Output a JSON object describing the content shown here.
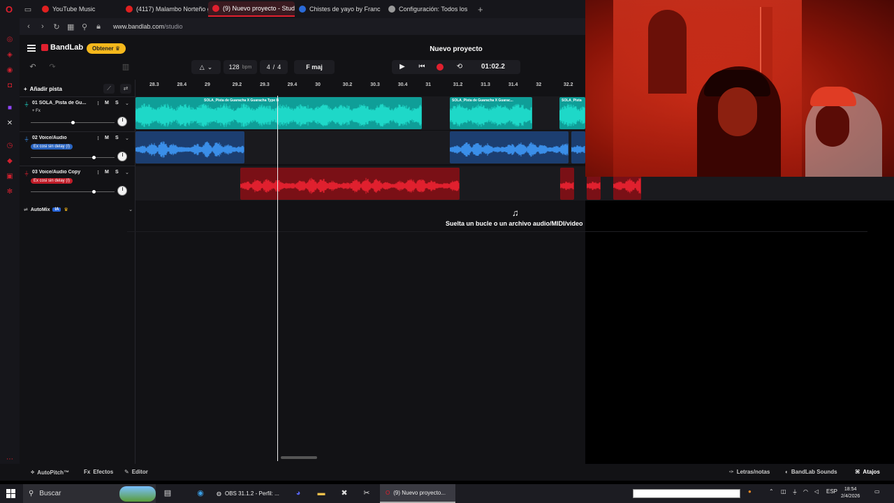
{
  "browser": {
    "tabs": [
      {
        "label": "YouTube Music",
        "color": "#e02020"
      },
      {
        "label": "(4117) Malambo Norteño g",
        "color": "#e02020"
      },
      {
        "label": "(9) Nuevo proyecto - Stud",
        "color": "#e0202e",
        "active": true
      },
      {
        "label": "Chistes de yayo by Franc",
        "color": "#2a6ad8"
      },
      {
        "label": "Configuración: Todos los",
        "color": "#999999"
      }
    ],
    "url_prefix": "www.bandlab.com",
    "url_path": "/studio"
  },
  "bandlab": {
    "logo": "BandLab",
    "get_button": "Obtener",
    "project_title": "Nuevo proyecto",
    "tempo": "128",
    "tempo_unit": "bpm",
    "time_signature_num": "4",
    "time_signature_sep": "/",
    "time_signature_den": "4",
    "key": "F maj",
    "timecode": "01:02.2",
    "add_track": "Añadir pista",
    "ruler": [
      "28.3",
      "28.4",
      "29",
      "29.2",
      "29.3",
      "29.4",
      "30",
      "30.2",
      "30.3",
      "30.4",
      "31",
      "31.2",
      "31.3",
      "31.4",
      "32",
      "32.2"
    ],
    "tracks": [
      {
        "name": "01  SOLA_Pista de Gu...",
        "fx": "+ Fx",
        "color": "#1ed8c8",
        "mute": "M",
        "solo": "S",
        "volume": 0.5
      },
      {
        "name": "02  Voice/Audio",
        "fx": "Ex cosi sin delay (I)",
        "color": "#3a8ee8",
        "mute": "M",
        "solo": "S",
        "volume": 0.75
      },
      {
        "name": "03  Voice/Audio Copy",
        "fx": "Ex cosi sin delay (I)",
        "color": "#e0202e",
        "mute": "M",
        "solo": "S",
        "volume": 0.75
      }
    ],
    "clips": {
      "track1_label": "SOLA_Pista de Guaracha X Guaracha Type B",
      "track1_label2": "SOLA_Pista de Guaracha X Guarac...",
      "track1_label3": "SOLA_Pista"
    },
    "automix": "AutoMix",
    "automix_badge": "IA",
    "drop_text": "Suelta un bucle o un archivo audio/MIDI/video",
    "bottom": {
      "autopitch": "AutoPitch™",
      "effects": "Efectos",
      "editor": "Editor",
      "lyrics": "Letras/notas",
      "sounds": "BandLab Sounds",
      "shortcuts": "Atajos"
    }
  },
  "taskbar": {
    "search": "Buscar",
    "obs": "OBS 31.1.2 - Perfil: ...",
    "bandlab": "(9) Nuevo proyecto...",
    "lang": "ESP",
    "time": "18:54",
    "date": "2/4/2026"
  }
}
